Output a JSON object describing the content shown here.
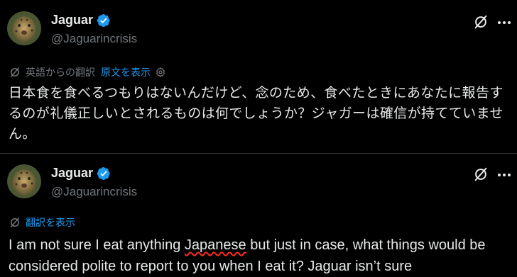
{
  "posts": [
    {
      "author": {
        "display_name": "Jaguar",
        "handle": "@Jaguarincrisis"
      },
      "translation_label": "英語からの翻訳",
      "show_original_label": "原文を表示",
      "text": "日本食を食べるつもりはないんだけど、念のため、食べたときにあなたに報告するのが礼儀正しいとされるものは何でしょうか？ジャガーは確信が持てていません。"
    },
    {
      "author": {
        "display_name": "Jaguar",
        "handle": "@Jaguarincrisis"
      },
      "translate_link": "翻訳を表示",
      "text_before": "I am not sure I eat anything ",
      "text_flagged": "Japanese",
      "text_after": " but just in case, what things would be considered polite to report to you when I eat it? Jaguar isn’t sure"
    }
  ],
  "colors": {
    "background": "#000000",
    "text": "#e7e9ea",
    "muted": "#71767b",
    "link": "#1d9bf0",
    "verified": "#1d9bf0",
    "spellcheck": "#ff2a2a"
  },
  "icons": [
    "avatar",
    "verified-badge-icon",
    "grok-icon",
    "more-icon",
    "translate-icon",
    "gear-icon"
  ]
}
